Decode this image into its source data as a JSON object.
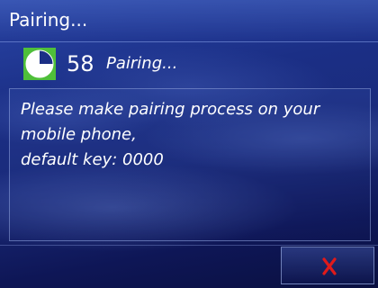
{
  "dialog": {
    "title": "Pairing...",
    "countdown": "58",
    "status": "Pairing...",
    "message_lines": [
      "Please make pairing process on your",
      "mobile phone,",
      "default key: 0000"
    ],
    "close_icon": "close-icon",
    "clock_icon": "clock-icon"
  },
  "colors": {
    "clock_bg": "#4fbf3a",
    "clock_face": "#ffffff",
    "close_red": "#e01a1a",
    "background_blue": "#1b2f86"
  }
}
